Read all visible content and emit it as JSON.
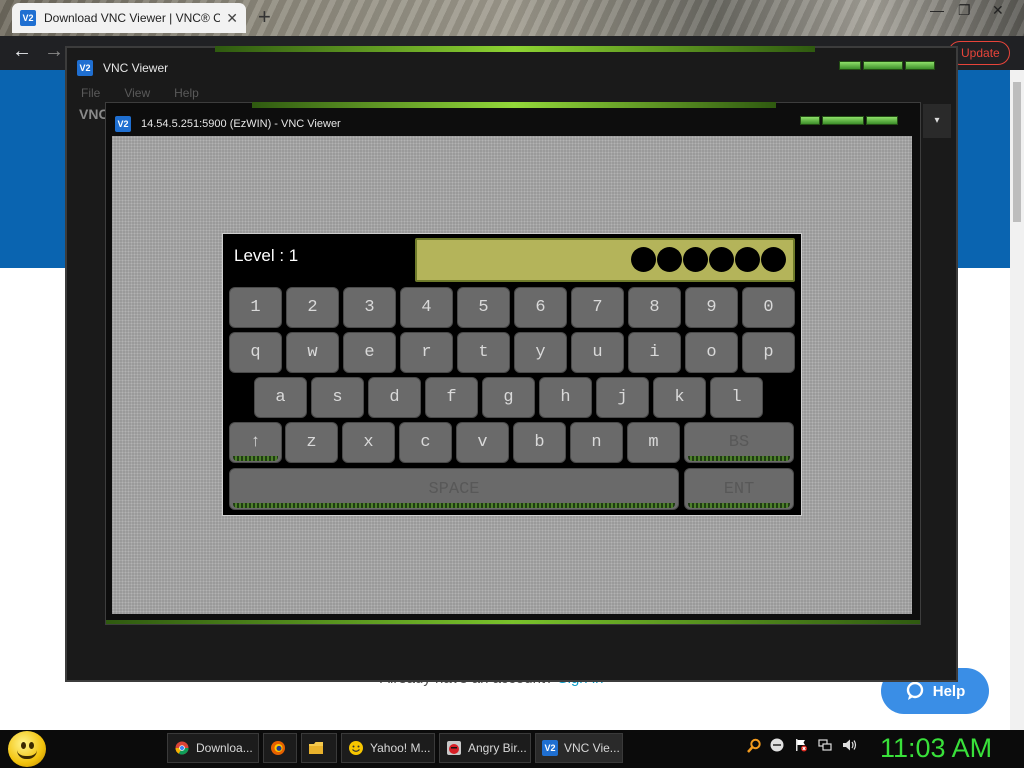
{
  "browser": {
    "tab_title": "Download VNC Viewer | VNC® C",
    "tab_close": "✕",
    "new_tab": "+",
    "update_button": "Update",
    "min_icon": "—",
    "max_icon": "❐",
    "close_icon": "✕"
  },
  "page": {
    "footer_text": "Already have an account?",
    "footer_link": "Sign in",
    "help_label": "Help"
  },
  "outer_window": {
    "icon_text": "V2",
    "title": "VNC Viewer",
    "menu": [
      "File",
      "View",
      "Help"
    ],
    "side_label": "VNC",
    "dropdown": "▾"
  },
  "inner_window": {
    "icon_text": "V2",
    "title": "14.54.5.251:5900 (EzWIN) - VNC Viewer"
  },
  "game": {
    "level_label": "Level : 1",
    "dots_count": 6,
    "rows": [
      [
        "1",
        "2",
        "3",
        "4",
        "5",
        "6",
        "7",
        "8",
        "9",
        "0"
      ],
      [
        "q",
        "w",
        "e",
        "r",
        "t",
        "y",
        "u",
        "i",
        "o",
        "p"
      ],
      [
        "a",
        "s",
        "d",
        "f",
        "g",
        "h",
        "j",
        "k",
        "l"
      ],
      [
        "z",
        "x",
        "c",
        "v",
        "b",
        "n",
        "m"
      ]
    ],
    "shift_label": "↑",
    "backspace_label": "BS",
    "space_label": "SPACE",
    "enter_label": "ENT"
  },
  "taskbar": {
    "items": [
      {
        "label": "Downloa...",
        "icon": "chrome-icon"
      },
      {
        "label": "",
        "icon": "firefox-icon"
      },
      {
        "label": "",
        "icon": "folder-icon"
      },
      {
        "label": "Yahoo! M...",
        "icon": "yahoo-messenger-icon"
      },
      {
        "label": "Angry Bir...",
        "icon": "angry-birds-icon"
      },
      {
        "label": "VNC Vie...",
        "icon": "vnc-icon"
      }
    ],
    "clock": "11:03 AM"
  }
}
